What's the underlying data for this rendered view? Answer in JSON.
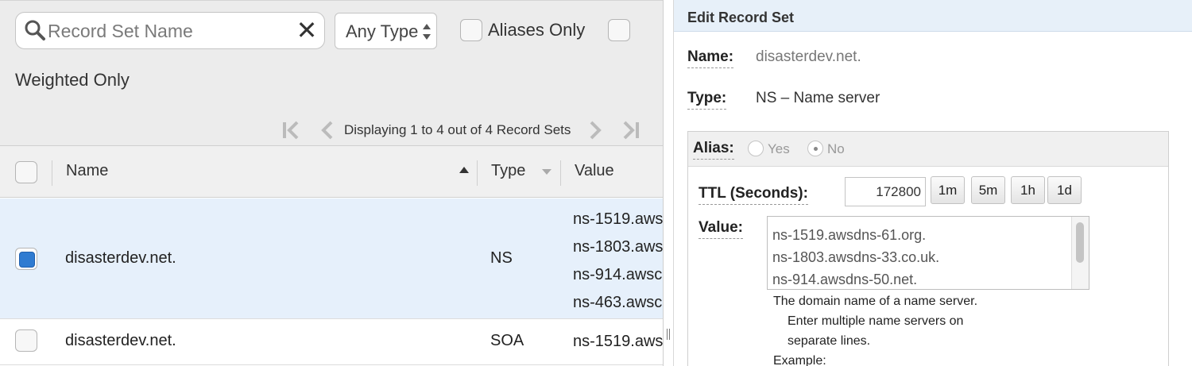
{
  "filters": {
    "search_placeholder": "Record Set Name",
    "clear_icon": "close-icon",
    "type_select_value": "Any Type",
    "aliases_only_label": "Aliases Only",
    "weighted_only_label": "Weighted Only"
  },
  "pager": {
    "status": "Displaying 1 to 4 out of 4 Record Sets"
  },
  "table": {
    "columns": [
      "Name",
      "Type",
      "Value"
    ],
    "rows": [
      {
        "selected": true,
        "name": "disasterdev.net.",
        "type": "NS",
        "values": [
          "ns-1519.aws",
          "ns-1803.aws",
          "ns-914.awsc",
          "ns-463.awsc"
        ]
      },
      {
        "selected": false,
        "name": "disasterdev.net.",
        "type": "SOA",
        "values": [
          "ns-1519.aws"
        ]
      }
    ]
  },
  "edit_panel": {
    "title": "Edit Record Set",
    "name_label": "Name:",
    "name_value": "disasterdev.net.",
    "type_label": "Type:",
    "type_value": "NS – Name server",
    "alias_label": "Alias:",
    "alias_yes": "Yes",
    "alias_no": "No",
    "alias_selected": "No",
    "ttl_label": "TTL (Seconds):",
    "ttl_value": "172800",
    "ttl_presets": [
      "1m",
      "5m",
      "1h",
      "1d"
    ],
    "value_label": "Value:",
    "value_lines": [
      "ns-1519.awsdns-61.org.",
      "ns-1803.awsdns-33.co.uk.",
      "ns-914.awsdns-50.net."
    ],
    "help_lines": [
      "The domain name of a name server.",
      "Enter multiple name servers on",
      "separate lines.",
      "Example:"
    ]
  },
  "colors": {
    "selected_row": "#e6f0fb",
    "checkbox_checked": "#2f7bd1",
    "panel_header": "#e7f0f9"
  }
}
